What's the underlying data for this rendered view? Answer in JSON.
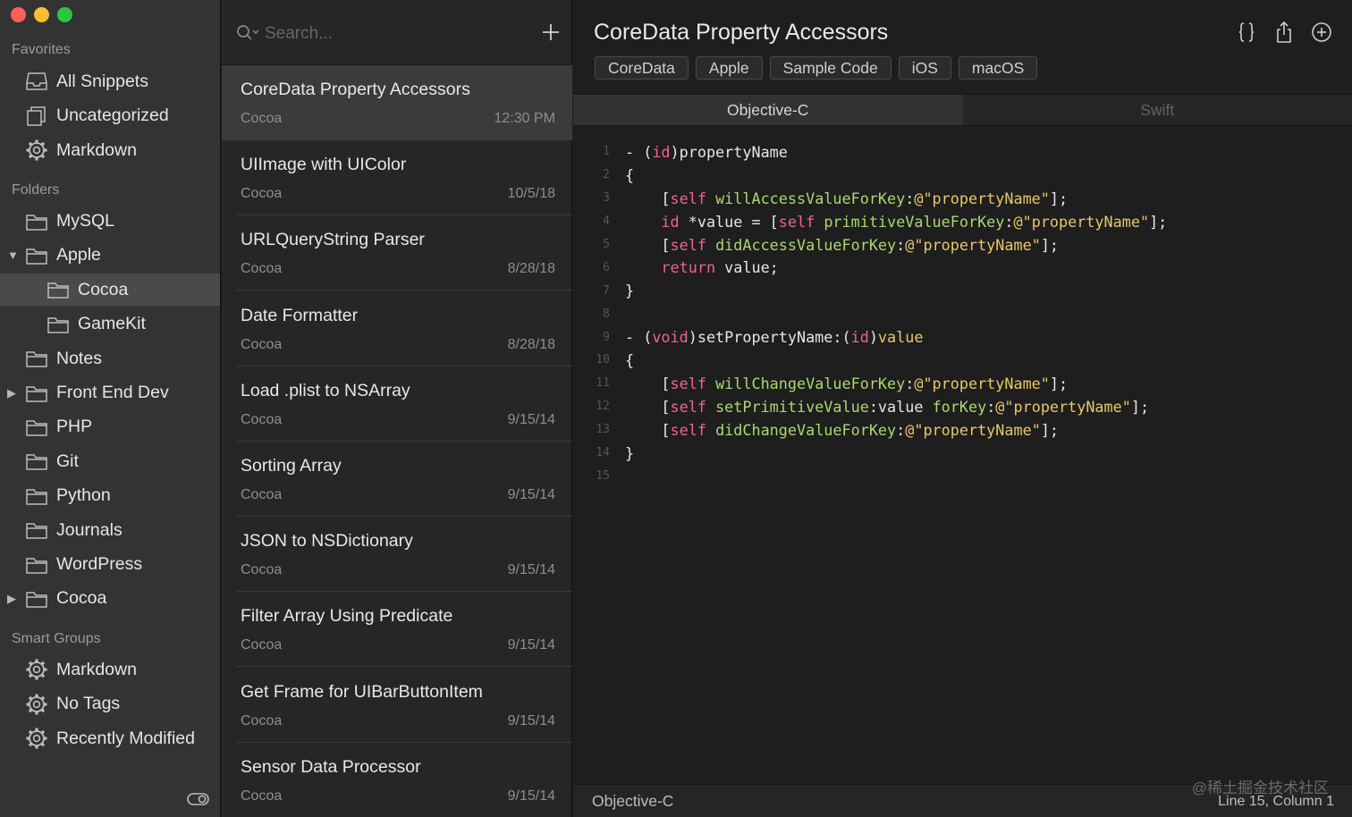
{
  "sidebar": {
    "sections": [
      {
        "key": "favorites",
        "label": "Favorites"
      },
      {
        "key": "folders",
        "label": "Folders"
      },
      {
        "key": "smart_groups",
        "label": "Smart Groups"
      }
    ],
    "favorites": [
      {
        "label": "All Snippets",
        "icon": "tray-icon"
      },
      {
        "label": "Uncategorized",
        "icon": "copy-icon"
      },
      {
        "label": "Markdown",
        "icon": "gear-icon"
      }
    ],
    "folders": [
      {
        "label": "MySQL",
        "icon": "folder-icon",
        "indent": 0,
        "disclosure": ""
      },
      {
        "label": "Apple",
        "icon": "folder-icon",
        "indent": 0,
        "disclosure": "expanded"
      },
      {
        "label": "Cocoa",
        "icon": "folder-icon",
        "indent": 1,
        "disclosure": "",
        "selected": true
      },
      {
        "label": "GameKit",
        "icon": "folder-icon",
        "indent": 1,
        "disclosure": ""
      },
      {
        "label": "Notes",
        "icon": "folder-icon",
        "indent": 0,
        "disclosure": ""
      },
      {
        "label": "Front End Dev",
        "icon": "folder-icon",
        "indent": 0,
        "disclosure": "collapsed"
      },
      {
        "label": "PHP",
        "icon": "folder-icon",
        "indent": 0,
        "disclosure": ""
      },
      {
        "label": "Git",
        "icon": "folder-icon",
        "indent": 0,
        "disclosure": ""
      },
      {
        "label": "Python",
        "icon": "folder-icon",
        "indent": 0,
        "disclosure": ""
      },
      {
        "label": "Journals",
        "icon": "folder-icon",
        "indent": 0,
        "disclosure": ""
      },
      {
        "label": "WordPress",
        "icon": "folder-icon",
        "indent": 0,
        "disclosure": ""
      },
      {
        "label": "Cocoa",
        "icon": "folder-icon",
        "indent": 0,
        "disclosure": "collapsed"
      }
    ],
    "smart_groups": [
      {
        "label": "Markdown",
        "icon": "gear-icon"
      },
      {
        "label": "No Tags",
        "icon": "gear-icon"
      },
      {
        "label": "Recently Modified",
        "icon": "gear-icon"
      }
    ]
  },
  "list": {
    "search_placeholder": "Search...",
    "notes": [
      {
        "title": "CoreData Property Accessors",
        "folder": "Cocoa",
        "date": "12:30 PM",
        "selected": true
      },
      {
        "title": "UIImage with UIColor",
        "folder": "Cocoa",
        "date": "10/5/18"
      },
      {
        "title": "URLQueryString Parser",
        "folder": "Cocoa",
        "date": "8/28/18"
      },
      {
        "title": "Date Formatter",
        "folder": "Cocoa",
        "date": "8/28/18"
      },
      {
        "title": "Load .plist to NSArray",
        "folder": "Cocoa",
        "date": "9/15/14"
      },
      {
        "title": "Sorting Array",
        "folder": "Cocoa",
        "date": "9/15/14"
      },
      {
        "title": "JSON to NSDictionary",
        "folder": "Cocoa",
        "date": "9/15/14"
      },
      {
        "title": "Filter Array Using Predicate",
        "folder": "Cocoa",
        "date": "9/15/14"
      },
      {
        "title": "Get Frame for UIBarButtonItem",
        "folder": "Cocoa",
        "date": "9/15/14"
      },
      {
        "title": "Sensor Data Processor",
        "folder": "Cocoa",
        "date": "9/15/14"
      }
    ]
  },
  "editor": {
    "title": "CoreData Property Accessors",
    "tags": [
      "CoreData",
      "Apple",
      "Sample Code",
      "iOS",
      "macOS"
    ],
    "tabs": [
      {
        "label": "Objective-C",
        "active": true
      },
      {
        "label": "Swift",
        "active": false
      }
    ],
    "code_lines": [
      [
        [
          "p",
          "- ("
        ],
        [
          "k",
          "id"
        ],
        [
          "p",
          ")propertyName"
        ]
      ],
      [
        [
          "p",
          "{"
        ]
      ],
      [
        [
          "p",
          "    ["
        ],
        [
          "k",
          "self"
        ],
        [
          "p",
          " "
        ],
        [
          "f",
          "willAccessValueForKey"
        ],
        [
          "p",
          ":"
        ],
        [
          "s",
          "@\"propertyName\""
        ],
        [
          "p",
          "];"
        ]
      ],
      [
        [
          "p",
          "    "
        ],
        [
          "k",
          "id"
        ],
        [
          "p",
          " *value = ["
        ],
        [
          "k",
          "self"
        ],
        [
          "p",
          " "
        ],
        [
          "f",
          "primitiveValueForKey"
        ],
        [
          "p",
          ":"
        ],
        [
          "s",
          "@\"propertyName\""
        ],
        [
          "p",
          "];"
        ]
      ],
      [
        [
          "p",
          "    ["
        ],
        [
          "k",
          "self"
        ],
        [
          "p",
          " "
        ],
        [
          "f",
          "didAccessValueForKey"
        ],
        [
          "p",
          ":"
        ],
        [
          "s",
          "@\"propertyName\""
        ],
        [
          "p",
          "];"
        ]
      ],
      [
        [
          "p",
          "    "
        ],
        [
          "k",
          "return"
        ],
        [
          "p",
          " value;"
        ]
      ],
      [
        [
          "p",
          "}"
        ]
      ],
      [
        [
          "p",
          ""
        ]
      ],
      [
        [
          "p",
          "- ("
        ],
        [
          "k",
          "void"
        ],
        [
          "p",
          ")setPropertyName:("
        ],
        [
          "k",
          "id"
        ],
        [
          "p",
          ")"
        ],
        [
          "s",
          "value"
        ]
      ],
      [
        [
          "p",
          "{"
        ]
      ],
      [
        [
          "p",
          "    ["
        ],
        [
          "k",
          "self"
        ],
        [
          "p",
          " "
        ],
        [
          "f",
          "willChangeValueForKey"
        ],
        [
          "p",
          ":"
        ],
        [
          "s",
          "@\"propertyName\""
        ],
        [
          "p",
          "];"
        ]
      ],
      [
        [
          "p",
          "    ["
        ],
        [
          "k",
          "self"
        ],
        [
          "p",
          " "
        ],
        [
          "f",
          "setPrimitiveValue"
        ],
        [
          "p",
          ":value "
        ],
        [
          "f",
          "forKey"
        ],
        [
          "p",
          ":"
        ],
        [
          "s",
          "@\"propertyName\""
        ],
        [
          "p",
          "];"
        ]
      ],
      [
        [
          "p",
          "    ["
        ],
        [
          "k",
          "self"
        ],
        [
          "p",
          " "
        ],
        [
          "f",
          "didChangeValueForKey"
        ],
        [
          "p",
          ":"
        ],
        [
          "s",
          "@\"propertyName\""
        ],
        [
          "p",
          "];"
        ]
      ],
      [
        [
          "p",
          "}"
        ]
      ],
      [
        [
          "p",
          ""
        ]
      ]
    ],
    "status_language": "Objective-C",
    "status_position": "Line 15, Column 1",
    "watermark": "@稀土掘金技术社区"
  }
}
